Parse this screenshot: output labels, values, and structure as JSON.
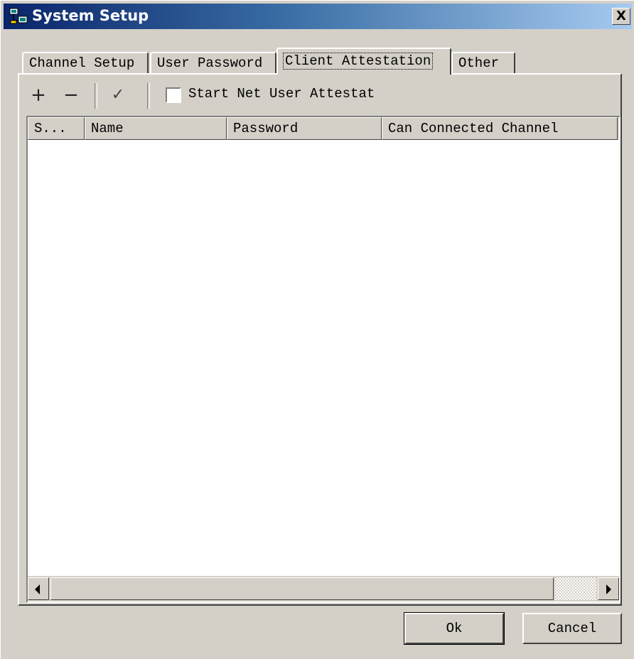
{
  "window": {
    "title": "System Setup",
    "close_glyph": "X",
    "icon": "network-computers-icon"
  },
  "tabs": [
    {
      "label": "Channel Setup",
      "active": false
    },
    {
      "label": "User Password",
      "active": false
    },
    {
      "label": "Client Attestation",
      "active": true
    },
    {
      "label": "Other",
      "active": false
    }
  ],
  "toolbar": {
    "add_glyph": "+",
    "remove_glyph": "−",
    "confirm_glyph": "✓",
    "checkbox_label": "Start Net User Attestat",
    "checkbox_checked": false
  },
  "list": {
    "columns": [
      "S...",
      "Name",
      "Password",
      "Can Connected Channel"
    ],
    "rows": []
  },
  "buttons": {
    "ok_label": "Ok",
    "cancel_label": "Cancel"
  },
  "colors": {
    "face": "#d4d0c8",
    "title_start": "#0a246a",
    "title_end": "#a6caf0"
  }
}
